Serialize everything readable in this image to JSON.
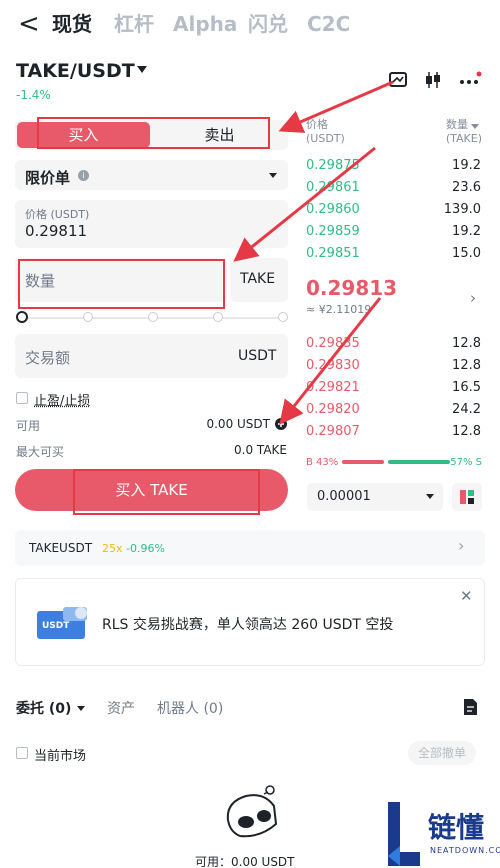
{
  "nav": {
    "back": "<",
    "tabs": [
      "现货",
      "杠杆",
      "Alpha",
      "闪兑",
      "C2C"
    ]
  },
  "pair": {
    "symbol": "TAKE/USDT",
    "change": "-1.4%"
  },
  "trade": {
    "buy_tab": "买入",
    "sell_tab": "卖出",
    "order_type": "限价单",
    "price_label": "价格 (USDT)",
    "price_value": "0.29811",
    "amount_placeholder": "数量",
    "amount_unit": "TAKE",
    "total_placeholder": "交易额",
    "total_unit": "USDT",
    "tpsl_label": "止盈/止损",
    "available_label": "可用",
    "available_value": "0.00 USDT",
    "max_buy_label": "最大可买",
    "max_buy_value": "0.0 TAKE",
    "buy_button": "买入 TAKE"
  },
  "orderbook": {
    "price_header_1": "价格",
    "price_header_2": "(USDT)",
    "qty_header_1": "数量",
    "qty_header_2": "(TAKE)",
    "asks": [
      {
        "price": "0.29875",
        "qty": "19.2"
      },
      {
        "price": "0.29861",
        "qty": "23.6"
      },
      {
        "price": "0.29860",
        "qty": "139.0"
      },
      {
        "price": "0.29859",
        "qty": "19.2"
      },
      {
        "price": "0.29851",
        "qty": "15.0"
      }
    ],
    "mid_price": "0.29813",
    "mid_cny": "≈ ¥2.11019",
    "bids": [
      {
        "price": "0.29835",
        "qty": "12.8"
      },
      {
        "price": "0.29830",
        "qty": "12.8"
      },
      {
        "price": "0.29821",
        "qty": "16.5"
      },
      {
        "price": "0.29820",
        "qty": "24.2"
      },
      {
        "price": "0.29807",
        "qty": "12.8"
      }
    ],
    "buy_ratio": "B 43%",
    "sell_ratio": "57% S",
    "buy_ratio_value": 43,
    "sell_ratio_value": 57,
    "precision": "0.00001"
  },
  "ticker": {
    "symbol": "TAKEUSDT",
    "leverage": "25x",
    "change": "-0.96%"
  },
  "promo": {
    "badge": "USDT",
    "text": "RLS 交易挑战赛，单人领高达 260 USDT 空投"
  },
  "orders": {
    "tab_orders": "委托 (0)",
    "tab_assets": "资产",
    "tab_bots": "机器人 (0)",
    "current_market": "当前市场",
    "cancel_all": "全部撤单",
    "available_bottom": "可用：0.00 USDT"
  },
  "watermark": {
    "brand": "链懂",
    "site": "NEATDOWN.COM"
  },
  "colors": {
    "buy": "#e85a6a",
    "sell_green": "#2ebd85",
    "annotation_red": "#e53946"
  }
}
